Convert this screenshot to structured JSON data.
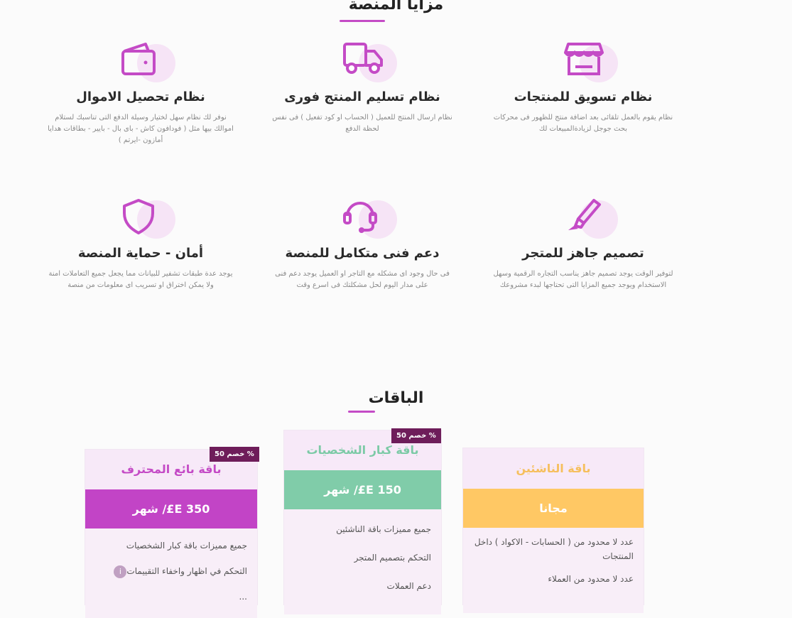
{
  "features_section": {
    "title": "مزايا المنصة",
    "items": [
      {
        "icon": "store-icon",
        "title": "نظام تسويق للمنتجات",
        "desc": "نظام يقوم بالعمل تلقائى بعد اضافة منتج للظهور فى محركات بحث جوجل لزيادةالمبيعات لك"
      },
      {
        "icon": "truck-icon",
        "title": "نظام تسليم المنتج فورى",
        "desc": "نظام ارسال المنتج للعميل ( الحساب او كود تفعيل ) فى نفس لحظة الدفع"
      },
      {
        "icon": "wallet-icon",
        "title": "نظام تحصيل الاموال",
        "desc": "نوفر لك نظام سهل لختيار وسيلة الدفع التى تناسبك لستلام اموالك بيها مثل ( فودافون كاش - باى بال - بايير - بطاقات هدايا أمازون -ايرتم )"
      },
      {
        "icon": "highlighter-icon",
        "title": "تصميم جاهز للمتجر",
        "desc": "لتوفير الوقت يوجد تصميم جاهز يناسب التجاره الرقمية وسهل الاستخدام ويوجد جميع المزايا التى تحتاجها لبدء مشروعك"
      },
      {
        "icon": "headset-icon",
        "title": "دعم فنى متكامل للمنصة",
        "desc": "فى حال وجود اى مشكله مع التاجر او العميل يوجد دعم فنى على مدار اليوم لحل مشكلتك فى اسرع وقت"
      },
      {
        "icon": "shield-icon",
        "title": "أمان - حماية المنصة",
        "desc": "يوجد عدة طبقات تشفير للبيانات مما يجعل جميع التعاملات امنة ولا يمكن اختراق او تسريب اى معلومات من منصة"
      }
    ]
  },
  "pricing_section": {
    "title": "الباقات",
    "plans": [
      {
        "name": "باقة الناشئين",
        "price": "مجانا",
        "badge": "",
        "name_color": "#f6bf5d",
        "price_bg": "#ffc864",
        "features": [
          "عدد لا محدود من ( الحسابات - الاكواد ) داخل المنتجات",
          "عدد لا محدود من العملاء"
        ]
      },
      {
        "name": "باقة كبار الشخصيات",
        "price": "150 E£/ شهر",
        "badge": "خصم 50 %",
        "name_color": "#7ccaa6",
        "price_bg": "#80cca9",
        "features": [
          "جميع مميزات باقة الناشئين",
          "التحكم بتصميم المتجر",
          "دعم العملات"
        ]
      },
      {
        "name": "باقة بائع المحترف",
        "price": "350 E£/ شهر",
        "badge": "خصم 50 %",
        "name_color": "#c44bc6",
        "price_bg": "#c244c6",
        "features": [
          "جميع مميزات باقة كبار الشخصيات",
          "التحكم في اظهار واخفاء التقييمات",
          "..."
        ]
      }
    ]
  }
}
